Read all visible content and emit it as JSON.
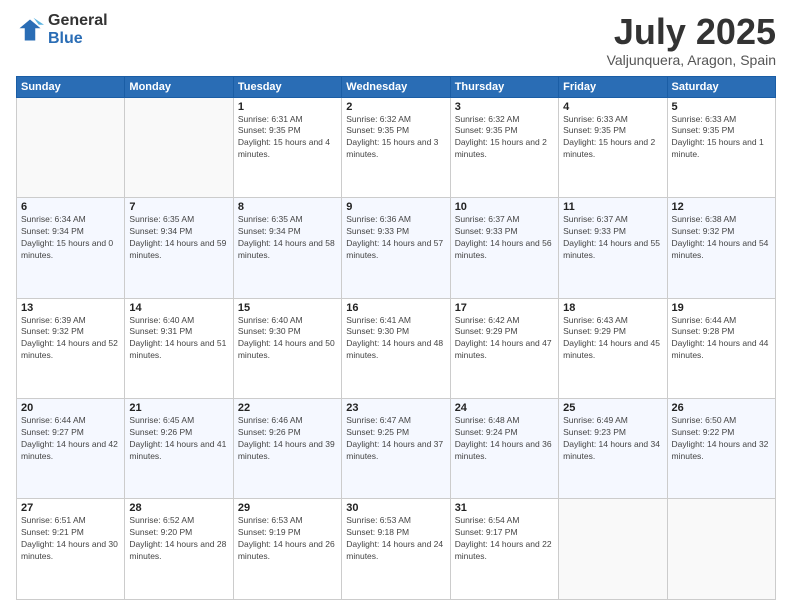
{
  "logo": {
    "general": "General",
    "blue": "Blue"
  },
  "title": {
    "month": "July 2025",
    "location": "Valjunquera, Aragon, Spain"
  },
  "weekdays": [
    "Sunday",
    "Monday",
    "Tuesday",
    "Wednesday",
    "Thursday",
    "Friday",
    "Saturday"
  ],
  "weeks": [
    [
      {
        "day": "",
        "sunrise": "",
        "sunset": "",
        "daylight": ""
      },
      {
        "day": "",
        "sunrise": "",
        "sunset": "",
        "daylight": ""
      },
      {
        "day": "1",
        "sunrise": "Sunrise: 6:31 AM",
        "sunset": "Sunset: 9:35 PM",
        "daylight": "Daylight: 15 hours and 4 minutes."
      },
      {
        "day": "2",
        "sunrise": "Sunrise: 6:32 AM",
        "sunset": "Sunset: 9:35 PM",
        "daylight": "Daylight: 15 hours and 3 minutes."
      },
      {
        "day": "3",
        "sunrise": "Sunrise: 6:32 AM",
        "sunset": "Sunset: 9:35 PM",
        "daylight": "Daylight: 15 hours and 2 minutes."
      },
      {
        "day": "4",
        "sunrise": "Sunrise: 6:33 AM",
        "sunset": "Sunset: 9:35 PM",
        "daylight": "Daylight: 15 hours and 2 minutes."
      },
      {
        "day": "5",
        "sunrise": "Sunrise: 6:33 AM",
        "sunset": "Sunset: 9:35 PM",
        "daylight": "Daylight: 15 hours and 1 minute."
      }
    ],
    [
      {
        "day": "6",
        "sunrise": "Sunrise: 6:34 AM",
        "sunset": "Sunset: 9:34 PM",
        "daylight": "Daylight: 15 hours and 0 minutes."
      },
      {
        "day": "7",
        "sunrise": "Sunrise: 6:35 AM",
        "sunset": "Sunset: 9:34 PM",
        "daylight": "Daylight: 14 hours and 59 minutes."
      },
      {
        "day": "8",
        "sunrise": "Sunrise: 6:35 AM",
        "sunset": "Sunset: 9:34 PM",
        "daylight": "Daylight: 14 hours and 58 minutes."
      },
      {
        "day": "9",
        "sunrise": "Sunrise: 6:36 AM",
        "sunset": "Sunset: 9:33 PM",
        "daylight": "Daylight: 14 hours and 57 minutes."
      },
      {
        "day": "10",
        "sunrise": "Sunrise: 6:37 AM",
        "sunset": "Sunset: 9:33 PM",
        "daylight": "Daylight: 14 hours and 56 minutes."
      },
      {
        "day": "11",
        "sunrise": "Sunrise: 6:37 AM",
        "sunset": "Sunset: 9:33 PM",
        "daylight": "Daylight: 14 hours and 55 minutes."
      },
      {
        "day": "12",
        "sunrise": "Sunrise: 6:38 AM",
        "sunset": "Sunset: 9:32 PM",
        "daylight": "Daylight: 14 hours and 54 minutes."
      }
    ],
    [
      {
        "day": "13",
        "sunrise": "Sunrise: 6:39 AM",
        "sunset": "Sunset: 9:32 PM",
        "daylight": "Daylight: 14 hours and 52 minutes."
      },
      {
        "day": "14",
        "sunrise": "Sunrise: 6:40 AM",
        "sunset": "Sunset: 9:31 PM",
        "daylight": "Daylight: 14 hours and 51 minutes."
      },
      {
        "day": "15",
        "sunrise": "Sunrise: 6:40 AM",
        "sunset": "Sunset: 9:30 PM",
        "daylight": "Daylight: 14 hours and 50 minutes."
      },
      {
        "day": "16",
        "sunrise": "Sunrise: 6:41 AM",
        "sunset": "Sunset: 9:30 PM",
        "daylight": "Daylight: 14 hours and 48 minutes."
      },
      {
        "day": "17",
        "sunrise": "Sunrise: 6:42 AM",
        "sunset": "Sunset: 9:29 PM",
        "daylight": "Daylight: 14 hours and 47 minutes."
      },
      {
        "day": "18",
        "sunrise": "Sunrise: 6:43 AM",
        "sunset": "Sunset: 9:29 PM",
        "daylight": "Daylight: 14 hours and 45 minutes."
      },
      {
        "day": "19",
        "sunrise": "Sunrise: 6:44 AM",
        "sunset": "Sunset: 9:28 PM",
        "daylight": "Daylight: 14 hours and 44 minutes."
      }
    ],
    [
      {
        "day": "20",
        "sunrise": "Sunrise: 6:44 AM",
        "sunset": "Sunset: 9:27 PM",
        "daylight": "Daylight: 14 hours and 42 minutes."
      },
      {
        "day": "21",
        "sunrise": "Sunrise: 6:45 AM",
        "sunset": "Sunset: 9:26 PM",
        "daylight": "Daylight: 14 hours and 41 minutes."
      },
      {
        "day": "22",
        "sunrise": "Sunrise: 6:46 AM",
        "sunset": "Sunset: 9:26 PM",
        "daylight": "Daylight: 14 hours and 39 minutes."
      },
      {
        "day": "23",
        "sunrise": "Sunrise: 6:47 AM",
        "sunset": "Sunset: 9:25 PM",
        "daylight": "Daylight: 14 hours and 37 minutes."
      },
      {
        "day": "24",
        "sunrise": "Sunrise: 6:48 AM",
        "sunset": "Sunset: 9:24 PM",
        "daylight": "Daylight: 14 hours and 36 minutes."
      },
      {
        "day": "25",
        "sunrise": "Sunrise: 6:49 AM",
        "sunset": "Sunset: 9:23 PM",
        "daylight": "Daylight: 14 hours and 34 minutes."
      },
      {
        "day": "26",
        "sunrise": "Sunrise: 6:50 AM",
        "sunset": "Sunset: 9:22 PM",
        "daylight": "Daylight: 14 hours and 32 minutes."
      }
    ],
    [
      {
        "day": "27",
        "sunrise": "Sunrise: 6:51 AM",
        "sunset": "Sunset: 9:21 PM",
        "daylight": "Daylight: 14 hours and 30 minutes."
      },
      {
        "day": "28",
        "sunrise": "Sunrise: 6:52 AM",
        "sunset": "Sunset: 9:20 PM",
        "daylight": "Daylight: 14 hours and 28 minutes."
      },
      {
        "day": "29",
        "sunrise": "Sunrise: 6:53 AM",
        "sunset": "Sunset: 9:19 PM",
        "daylight": "Daylight: 14 hours and 26 minutes."
      },
      {
        "day": "30",
        "sunrise": "Sunrise: 6:53 AM",
        "sunset": "Sunset: 9:18 PM",
        "daylight": "Daylight: 14 hours and 24 minutes."
      },
      {
        "day": "31",
        "sunrise": "Sunrise: 6:54 AM",
        "sunset": "Sunset: 9:17 PM",
        "daylight": "Daylight: 14 hours and 22 minutes."
      },
      {
        "day": "",
        "sunrise": "",
        "sunset": "",
        "daylight": ""
      },
      {
        "day": "",
        "sunrise": "",
        "sunset": "",
        "daylight": ""
      }
    ]
  ]
}
